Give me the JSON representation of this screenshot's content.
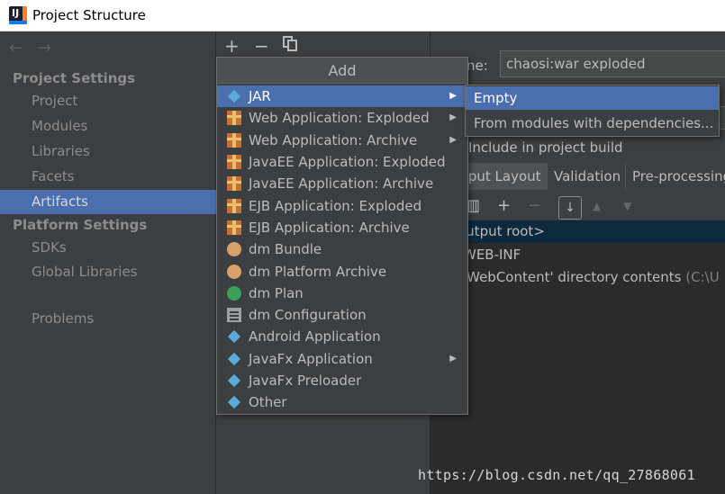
{
  "window": {
    "title": "Project Structure"
  },
  "sidebar": {
    "project_settings_header": "Project Settings",
    "platform_settings_header": "Platform Settings",
    "items": [
      {
        "label": "Project"
      },
      {
        "label": "Modules"
      },
      {
        "label": "Libraries"
      },
      {
        "label": "Facets"
      },
      {
        "label": "Artifacts",
        "selected": true
      },
      {
        "label": "SDKs"
      },
      {
        "label": "Global Libraries"
      },
      {
        "label": "Problems"
      }
    ]
  },
  "toolbar": {
    "add": "+",
    "remove": "−"
  },
  "right_panel": {
    "name_label": "ne:",
    "name_value": "chaosi:war exploded",
    "include_label": "Include in project build",
    "tabs": [
      "tput Layout",
      "Validation",
      "Pre-processing"
    ],
    "tree": {
      "root": "output root>",
      "item1": "WEB-INF",
      "item2_main": "'WebContent' directory contents",
      "item2_path": "(C:\\U"
    }
  },
  "popup": {
    "title": "Add",
    "items": [
      {
        "label": "JAR",
        "icon": "diamond-icon",
        "submenu": true,
        "highlighted": true
      },
      {
        "label": "Web Application: Exploded",
        "icon": "gift-icon",
        "submenu": true
      },
      {
        "label": "Web Application: Archive",
        "icon": "gift-icon",
        "submenu": true
      },
      {
        "label": "JavaEE Application: Exploded",
        "icon": "gift-icon"
      },
      {
        "label": "JavaEE Application: Archive",
        "icon": "gift-icon"
      },
      {
        "label": "EJB Application: Exploded",
        "icon": "gift-icon"
      },
      {
        "label": "EJB Application: Archive",
        "icon": "gift-icon"
      },
      {
        "label": "dm Bundle",
        "icon": "bundle-icon"
      },
      {
        "label": "dm Platform Archive",
        "icon": "bundle-icon"
      },
      {
        "label": "dm Plan",
        "icon": "globe-icon"
      },
      {
        "label": "dm Configuration",
        "icon": "document-icon"
      },
      {
        "label": "Android Application",
        "icon": "diamond-icon"
      },
      {
        "label": "JavaFx Application",
        "icon": "diamond-icon",
        "submenu": true
      },
      {
        "label": "JavaFx Preloader",
        "icon": "diamond-icon"
      },
      {
        "label": "Other",
        "icon": "diamond-icon"
      }
    ]
  },
  "submenu": {
    "items": [
      {
        "label": "Empty",
        "highlighted": true
      },
      {
        "label": "From modules with dependencies..."
      }
    ]
  },
  "watermark": "https://blog.csdn.net/qq_27868061",
  "colors": {
    "selection": "#4b6eaf",
    "background": "#3c3f41"
  }
}
